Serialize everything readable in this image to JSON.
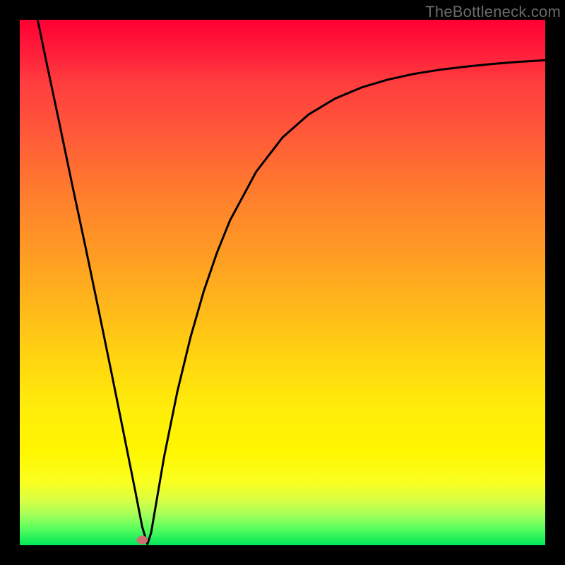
{
  "watermark": "TheBottleneck.com",
  "chart_data": {
    "type": "line",
    "title": "",
    "xlabel": "",
    "ylabel": "",
    "xlim": [
      0,
      100
    ],
    "ylim": [
      0,
      100
    ],
    "grid": false,
    "series": [
      {
        "name": "curve",
        "x": [
          3.4,
          5,
          7.5,
          10,
          12.5,
          15,
          17.5,
          20,
          22,
          23.3,
          24.3,
          25,
          27.5,
          30,
          32.5,
          35,
          37.5,
          40,
          45,
          50,
          55,
          60,
          65,
          70,
          75,
          80,
          85,
          90,
          95,
          100
        ],
        "y": [
          100,
          92.3,
          80.5,
          68.5,
          56.8,
          44.8,
          32.6,
          20.2,
          10.2,
          3.5,
          0.2,
          2.4,
          17.0,
          29.3,
          39.6,
          48.3,
          55.6,
          61.8,
          71.1,
          77.6,
          82.0,
          85.0,
          87.1,
          88.6,
          89.7,
          90.5,
          91.1,
          91.6,
          92.0,
          92.3
        ]
      }
    ],
    "marker": {
      "x": 23.3,
      "y": 1.0,
      "color": "#cc6e72"
    },
    "background_gradient": {
      "top": "#ff0033",
      "upper_mid": "#ff7a2e",
      "mid": "#ffd610",
      "lower_mid": "#faff20",
      "bottom": "#00e858"
    }
  }
}
